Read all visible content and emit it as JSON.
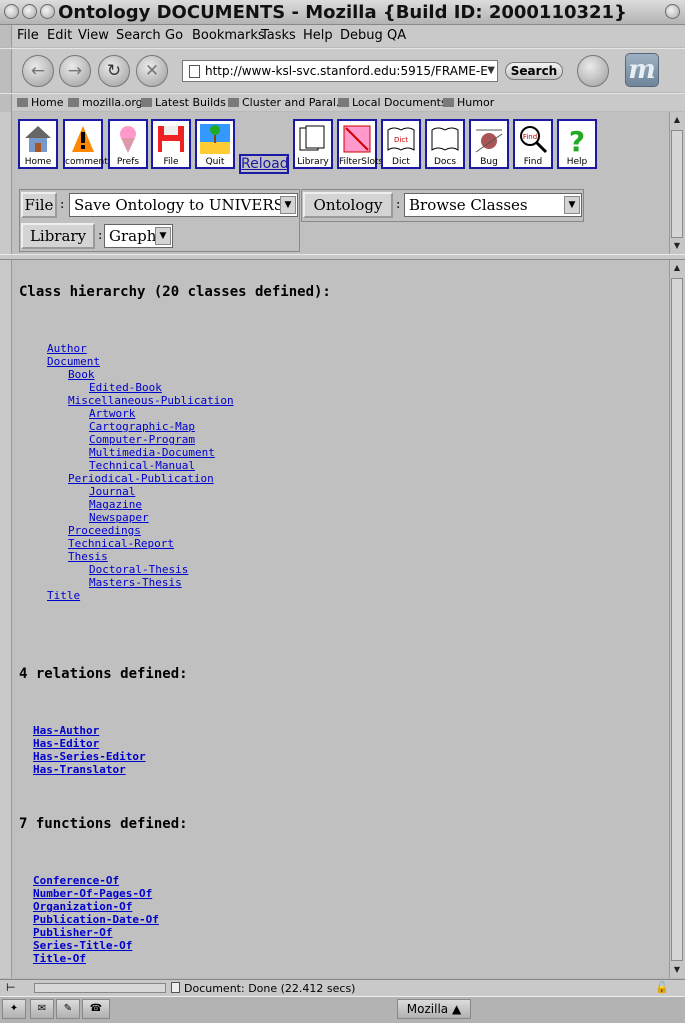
{
  "window": {
    "title": "Ontology DOCUMENTS - Mozilla {Build ID: 2000110321}"
  },
  "menubar": {
    "items": [
      "File",
      "Edit",
      "View",
      "Search",
      "Go",
      "Bookmarks",
      "Tasks",
      "Help",
      "Debug",
      "QA"
    ]
  },
  "navbar": {
    "url": "http://www-ksl-svc.stanford.edu:5915/FRAME-E",
    "search_label": "Search"
  },
  "personal_toolbar": {
    "items": [
      "Home",
      "mozilla.org",
      "Latest Builds",
      "Cluster and Paral...",
      "Local Documents",
      "Humor"
    ]
  },
  "tools": [
    {
      "label": "Home"
    },
    {
      "label": "comment"
    },
    {
      "label": "Prefs"
    },
    {
      "label": "File"
    },
    {
      "label": "Quit"
    },
    {
      "label": "Library"
    },
    {
      "label": "FilterSlots"
    },
    {
      "label": "Dict"
    },
    {
      "label": "Docs"
    },
    {
      "label": "Bug"
    },
    {
      "label": "Find"
    },
    {
      "label": "Help"
    }
  ],
  "reload_label": "Reload",
  "form": {
    "file_button": "File",
    "file_select": "Save Ontology to UNIVERSE",
    "ontology_button": "Ontology",
    "ontology_select": "Browse Classes",
    "library_button": "Library",
    "library_select": "Graph",
    "colon": ":"
  },
  "content": {
    "class_heading": "Class hierarchy (20 classes defined):",
    "classes": [
      {
        "name": "Author",
        "level": 0
      },
      {
        "name": "Document",
        "level": 0
      },
      {
        "name": "Book",
        "level": 1
      },
      {
        "name": "Edited-Book",
        "level": 2
      },
      {
        "name": "Miscellaneous-Publication",
        "level": 1
      },
      {
        "name": "Artwork",
        "level": 2
      },
      {
        "name": "Cartographic-Map",
        "level": 2
      },
      {
        "name": "Computer-Program",
        "level": 2
      },
      {
        "name": "Multimedia-Document",
        "level": 2
      },
      {
        "name": "Technical-Manual",
        "level": 2
      },
      {
        "name": "Periodical-Publication",
        "level": 1
      },
      {
        "name": "Journal",
        "level": 2
      },
      {
        "name": "Magazine",
        "level": 2
      },
      {
        "name": "Newspaper",
        "level": 2
      },
      {
        "name": "Proceedings",
        "level": 1
      },
      {
        "name": "Technical-Report",
        "level": 1
      },
      {
        "name": "Thesis",
        "level": 1
      },
      {
        "name": "Doctoral-Thesis",
        "level": 2
      },
      {
        "name": "Masters-Thesis",
        "level": 2
      },
      {
        "name": "Title",
        "level": 0
      }
    ],
    "relations_heading": "4 relations defined:",
    "relations": [
      "Has-Author",
      "Has-Editor",
      "Has-Series-Editor",
      "Has-Translator"
    ],
    "functions_heading": "7 functions defined:",
    "functions": [
      "Conference-Of",
      "Number-Of-Pages-Of",
      "Organization-Of",
      "Publication-Date-Of",
      "Publisher-Of",
      "Series-Title-Of",
      "Title-Of"
    ]
  },
  "status": {
    "text": "Document: Done (22.412 secs)"
  },
  "taskbar": {
    "mozilla_label": "Mozilla"
  }
}
